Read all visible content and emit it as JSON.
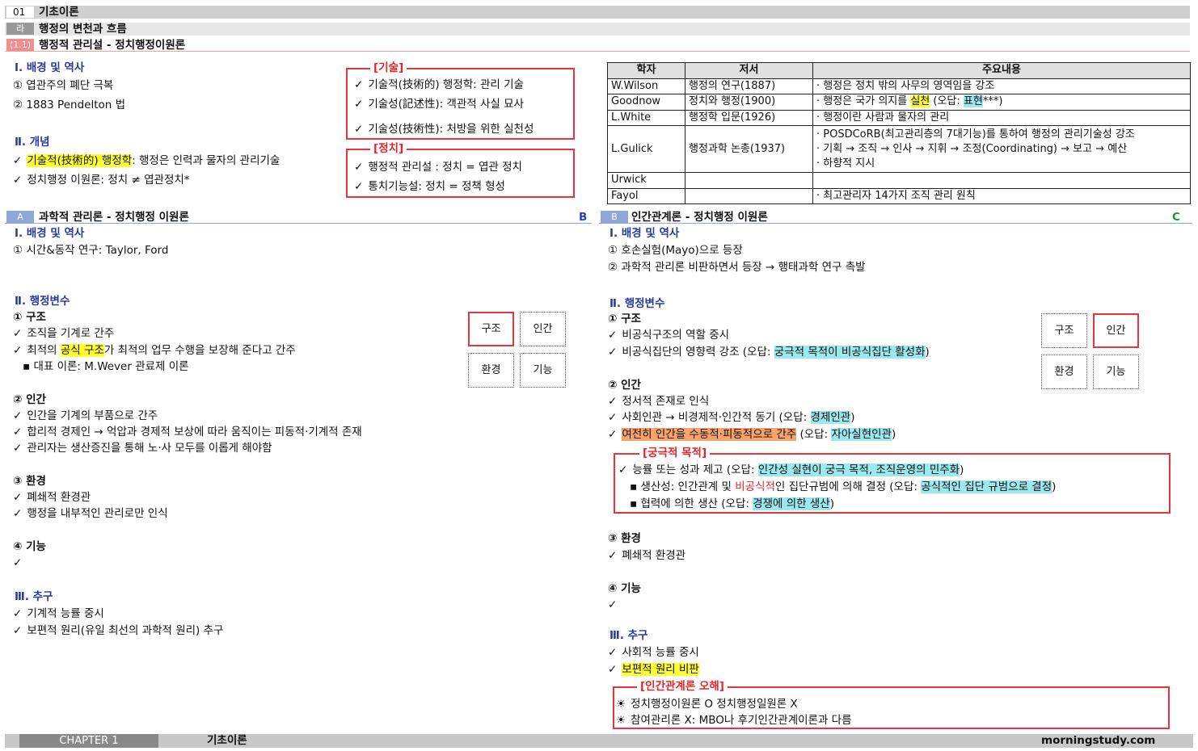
{
  "header": {
    "chapter_num": "01",
    "chapter_title": "기초이론",
    "sub_tag": "라",
    "sub_title": "행정의 변천과 흐름",
    "topic_tag": "(1.1)",
    "topic_title": "행정적 관리설 - 정치행정이원론"
  },
  "top_left": {
    "bg_title": "Ⅰ. 배경 및 역사",
    "bg_items": [
      "① 엽관주의 폐단 극복",
      "② 1883 Pendelton 법"
    ],
    "concept_title": "Ⅱ. 개념",
    "concept_1_hl": "기술적(技術的) 행정학",
    "concept_1_rest": ": 행정은 인력과 물자의 관리기술",
    "concept_2": "정치행정 이원론: 정치 ≠ 엽관정치*"
  },
  "box_gisul": {
    "title": "[기술]",
    "items": [
      "기술적(技術的) 행정학: 관리 기술",
      "기술성(記述性): 객관적 사실 묘사",
      "기술성(技術性): 처방을 위한 실천성"
    ]
  },
  "box_jeongchi": {
    "title": "[정치]",
    "items": [
      "행정적 관리설 : 정치 = 엽관 정치",
      "통치기능설: 정치 = 정책 형성"
    ]
  },
  "table": {
    "headers": [
      "학자",
      "저서",
      "주요내용"
    ],
    "rows": [
      {
        "scholar": "W.Wilson",
        "book": "행정의 연구(1887)",
        "content": "· 행정은 정치 밖의 사무의 영역임을 강조"
      },
      {
        "scholar": "Goodnow",
        "book": "정치와 행정(1900)",
        "content_pre": "· 행정은 국가 의지를 ",
        "content_hl": "실천",
        "content_mid": " (오답: ",
        "content_hl2": "표현",
        "content_post": "***)"
      },
      {
        "scholar": "L.White",
        "book": "행정학 입문(1926)",
        "content": "· 행정이란 사람과 물자의 관리"
      },
      {
        "scholar": "L.Gulick",
        "book": "행정과학 논총(1937)",
        "content_lines": [
          "· POSDCoRB(최고관리층의 7대기능)를 통하여 행정의 관리기술성 강조",
          "· 기획 → 조직 → 인사 → 지휘 → 조정(Coordinating) → 보고 → 예산",
          "· 하향적 지시"
        ]
      },
      {
        "scholar": "Urwick",
        "book": "",
        "content": ""
      },
      {
        "scholar": "Fayol",
        "book": "",
        "content": "· 최고관리자 14가지 조직 관리 원칙"
      }
    ]
  },
  "sec_a": {
    "tag": "A",
    "title": "과학적 관리론 - 정치행정 이원론",
    "right_mark": "B",
    "bg_title": "Ⅰ. 배경 및 역사",
    "bg_item": "① 시간&동작 연구: Taylor, Ford",
    "var_title": "Ⅱ. 행정변수",
    "s1": "① 구조",
    "s1_a": "조직을 기계로 간주",
    "s1_b_pre": "최적의 ",
    "s1_b_hl": "공식 구조",
    "s1_b_post": "가 최적의 업무 수행을 보장해 준다고 간주",
    "s1_c": "▪ 대표 이론: M.Wever 관료제 이론",
    "s2": "② 인간",
    "s2_items": [
      "인간을 기계의 부품으로 간주",
      "합리적 경제인 → 억압과 경제적 보상에 따라 움직이는 피동적·기계적 존재",
      "관리자는 생산증진을 통해 노·사 모두를 이롭게 해야함"
    ],
    "s3": "③ 환경",
    "s3_items": [
      "폐쇄적 환경관",
      "행정을 내부적인 관리로만 인식"
    ],
    "s4": "④ 기능",
    "goal_title": "Ⅲ. 추구",
    "goal_items": [
      "기계적 능률 중시",
      "보편적 원리(유일 최선의 과학적 원리) 추구"
    ],
    "boxes": [
      "구조",
      "인간",
      "환경",
      "기능"
    ]
  },
  "sec_b": {
    "tag": "B",
    "title": "인간관계론 - 정치행정 이원론",
    "right_mark": "C",
    "bg_title": "Ⅰ. 배경 및 역사",
    "bg_items": [
      "① 호손실험(Mayo)으로 등장",
      "② 과학적 관리론 비판하면서 등장 → 행태과학 연구 촉발"
    ],
    "var_title": "Ⅱ. 행정변수",
    "s1": "① 구조",
    "s1_a": "비공식구조의 역할 중시",
    "s1_b_pre": "비공식집단의 영향력 강조 (오답: ",
    "s1_b_hl": "궁극적 목적이 비공식집단 활성화",
    "s1_b_post": ")",
    "s2": "② 인간",
    "s2_a": "정서적 존재로 인식",
    "s2_b_pre": "사회인관 → 비경제적·인간적 동기 (오답: ",
    "s2_b_hl": "경제인관",
    "s2_b_post": ")",
    "s2_c_hl": "여전히 인간을 수동적·피동적으로 간주",
    "s2_c_mid": " (오답: ",
    "s2_c_hl2": "자아실현인관",
    "s2_c_post": ")",
    "ultimate": {
      "title": "[궁극적 목적]",
      "l1_pre": "능률 또는 성과 제고 (오답: ",
      "l1_hl": "인간성 실현이 궁극 목적, 조직운영의 민주화",
      "l1_post": ")",
      "l2_pre": "▪ 생산성: 인간관계 및 ",
      "l2_red": "비공식적",
      "l2_mid": "인 집단규범에 의해 결정 (오답: ",
      "l2_hl": "공식적인 집단 규범으로 결정",
      "l2_post": ")",
      "l3_pre": "▪ 협력에 의한 생산 (오답: ",
      "l3_hl": "경쟁에 의한 생산",
      "l3_post": ")"
    },
    "s3": "③ 환경",
    "s3_a": "폐쇄적 환경관",
    "s4": "④ 기능",
    "goal_title": "Ⅲ. 추구",
    "goal_a": "사회적 능률 중시",
    "goal_b_hl": "보편적 원리 비판",
    "misc": {
      "title": "[인간관계론 오해]",
      "items": [
        "정치행정이원론 O 정치행정일원론 X",
        "참여관리론 X: MBO나 후기인간관계이론과 다름"
      ]
    },
    "boxes": [
      "구조",
      "인간",
      "환경",
      "기능"
    ]
  },
  "footer": {
    "chapter": "CHAPTER 1",
    "title": "기초이론",
    "site": "morningstudy.com"
  },
  "colors": {
    "section_heading": "#2a3a9a",
    "red_accent": "#e8343b",
    "highlight_yellow": "#ffff33",
    "highlight_cyan": "#9be8ee",
    "highlight_orange": "#f7a36b"
  },
  "icons": {
    "check": "✓",
    "bullet_sun": "☀"
  }
}
